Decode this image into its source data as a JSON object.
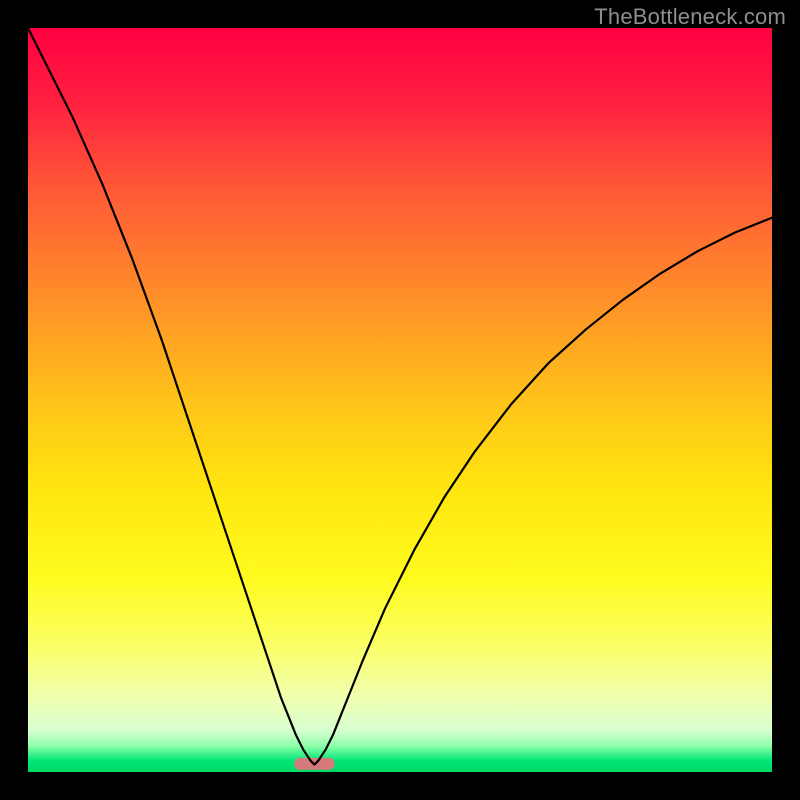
{
  "watermark": "TheBottleneck.com",
  "chart_data": {
    "type": "line",
    "title": "",
    "xlabel": "",
    "ylabel": "",
    "xlim": [
      0,
      100
    ],
    "ylim": [
      0,
      100
    ],
    "grid": false,
    "legend": false,
    "background_gradient_stops": [
      {
        "pos": 0.0,
        "color": "#ff0040"
      },
      {
        "pos": 0.1,
        "color": "#ff2040"
      },
      {
        "pos": 0.22,
        "color": "#ff5a36"
      },
      {
        "pos": 0.35,
        "color": "#ff8a2a"
      },
      {
        "pos": 0.5,
        "color": "#ffc31a"
      },
      {
        "pos": 0.62,
        "color": "#ffe60f"
      },
      {
        "pos": 0.74,
        "color": "#fffb1e"
      },
      {
        "pos": 0.83,
        "color": "#fbff66"
      },
      {
        "pos": 0.9,
        "color": "#f0ffb0"
      },
      {
        "pos": 0.945,
        "color": "#d6ffd0"
      },
      {
        "pos": 0.965,
        "color": "#8effa8"
      },
      {
        "pos": 0.985,
        "color": "#00e676"
      },
      {
        "pos": 1.0,
        "color": "#00d966"
      }
    ],
    "marker": {
      "x": 38.5,
      "y": 1.1,
      "width": 5.4,
      "height": 1.6,
      "color": "#d47a7a",
      "rx": 5
    },
    "series": [
      {
        "name": "curve",
        "color": "#000000",
        "stroke_width": 2.2,
        "x": [
          0,
          2,
          4,
          6,
          8,
          10,
          12,
          14,
          16,
          18,
          20,
          22,
          24,
          26,
          28,
          30,
          32,
          33,
          34,
          35,
          36,
          37,
          38,
          38.5,
          39,
          40,
          41,
          42,
          43,
          45,
          48,
          52,
          56,
          60,
          65,
          70,
          75,
          80,
          85,
          90,
          95,
          100
        ],
        "y": [
          100,
          96,
          92,
          88,
          83.5,
          79,
          74,
          69,
          63.5,
          58,
          52,
          46,
          40,
          34,
          28,
          22,
          16,
          13,
          10,
          7.5,
          5,
          3,
          1.5,
          1,
          1.5,
          3,
          5,
          7.5,
          10,
          15,
          22,
          30,
          37,
          43,
          49.5,
          55,
          59.5,
          63.5,
          67,
          70,
          72.5,
          74.5
        ]
      }
    ]
  }
}
